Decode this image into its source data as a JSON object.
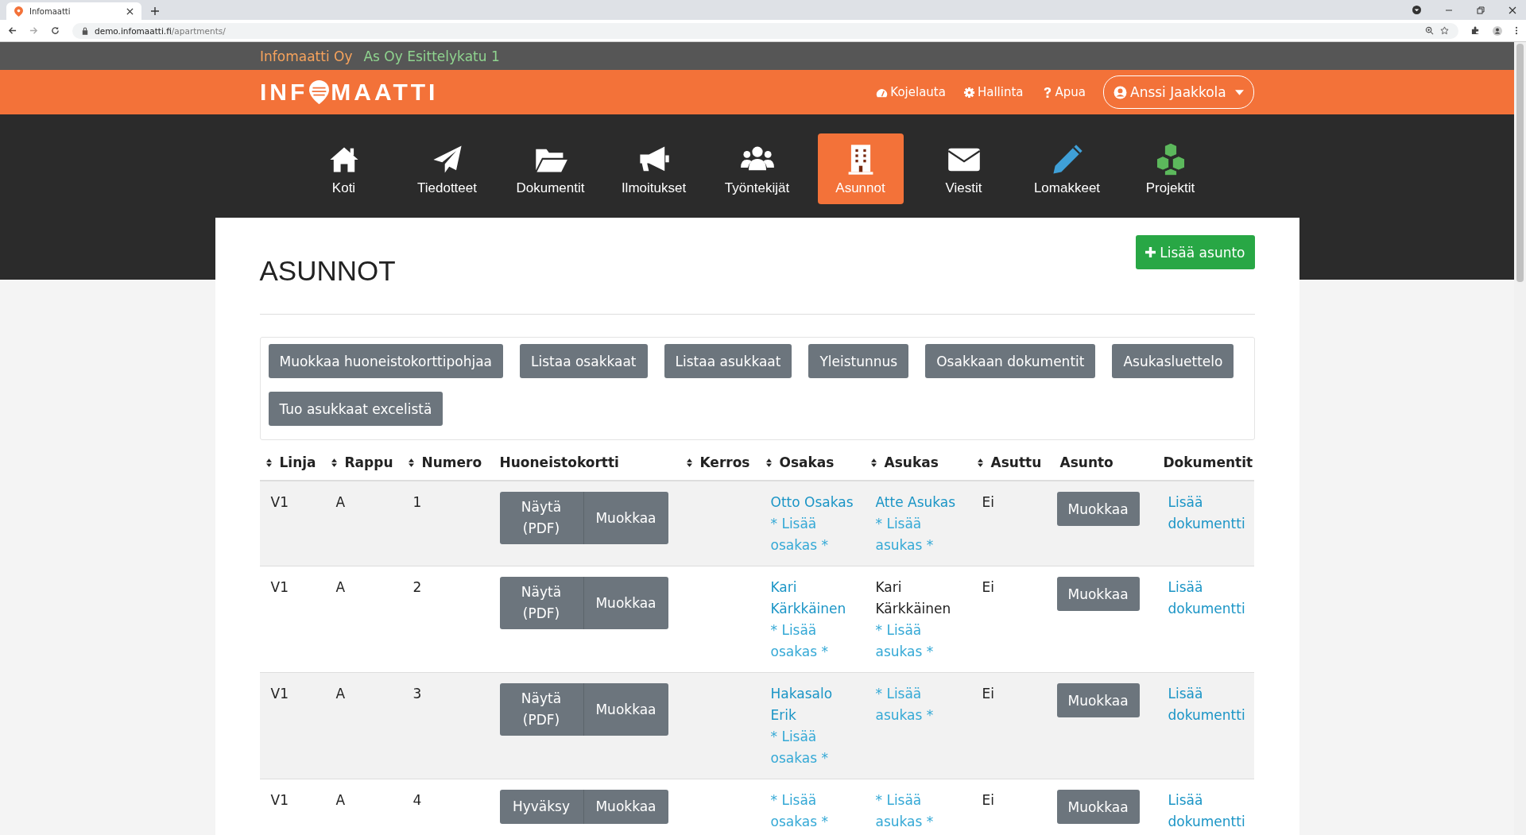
{
  "browser": {
    "tab_title": "Infomaatti",
    "url_domain": "demo.infomaatti.fi",
    "url_path": "/apartments/"
  },
  "topbar": {
    "company": "Infomaatti Oy",
    "association": "As Oy Esittelykatu 1"
  },
  "header": {
    "logo_left": "INF",
    "logo_right": "MAATTI",
    "links": [
      {
        "label": "Kojelauta"
      },
      {
        "label": "Hallinta"
      },
      {
        "label": "Apua"
      }
    ],
    "user": "Anssi Jaakkola"
  },
  "nav": [
    {
      "label": "Koti",
      "selected": false
    },
    {
      "label": "Tiedotteet",
      "selected": false
    },
    {
      "label": "Dokumentit",
      "selected": false
    },
    {
      "label": "Ilmoitukset",
      "selected": false
    },
    {
      "label": "Työntekijät",
      "selected": false
    },
    {
      "label": "Asunnot",
      "selected": true
    },
    {
      "label": "Viestit",
      "selected": false
    },
    {
      "label": "Lomakkeet",
      "selected": false
    },
    {
      "label": "Projektit",
      "selected": false
    }
  ],
  "page": {
    "title": "ASUNNOT",
    "add_button": "Lisää asunto",
    "actions": [
      "Muokkaa huoneistokorttipohjaa",
      "Listaa osakkaat",
      "Listaa asukkaat",
      "Yleistunnus",
      "Osakkaan dokumentit",
      "Asukasluettelo",
      "Tuo asukkaat excelistä"
    ]
  },
  "table": {
    "columns": [
      {
        "label": "Linja",
        "sortable": true
      },
      {
        "label": "Rappu",
        "sortable": true
      },
      {
        "label": "Numero",
        "sortable": true
      },
      {
        "label": "Huoneistokortti",
        "sortable": false
      },
      {
        "label": "Kerros",
        "sortable": true
      },
      {
        "label": "Osakas",
        "sortable": true
      },
      {
        "label": "Asukas",
        "sortable": true
      },
      {
        "label": "Asuttu",
        "sortable": true
      },
      {
        "label": "Asunto",
        "sortable": false
      },
      {
        "label": "Dokumentit",
        "sortable": false
      }
    ],
    "rows": [
      {
        "linja": "V1",
        "rappu": "A",
        "numero": "1",
        "card_buttons": [
          "Näytä (PDF)",
          "Muokkaa"
        ],
        "osakas": "Otto Osakas",
        "osakas_add": "* Lisää osakas *",
        "asukas": "Atte Asukas",
        "asukas_linked": true,
        "asukas_add": "* Lisää asukas *",
        "asuttu": "Ei",
        "edit": "Muokkaa",
        "document": "Lisää dokumentti"
      },
      {
        "linja": "V1",
        "rappu": "A",
        "numero": "2",
        "card_buttons": [
          "Näytä (PDF)",
          "Muokkaa"
        ],
        "osakas": "Kari Kärkkäinen",
        "osakas_add": "* Lisää osakas *",
        "asukas": "Kari Kärkkäinen",
        "asukas_linked": false,
        "asukas_add": "* Lisää asukas *",
        "asuttu": "Ei",
        "edit": "Muokkaa",
        "document": "Lisää dokumentti"
      },
      {
        "linja": "V1",
        "rappu": "A",
        "numero": "3",
        "card_buttons": [
          "Näytä (PDF)",
          "Muokkaa"
        ],
        "osakas": "Hakasalo Erik",
        "osakas_add": "* Lisää osakas *",
        "asukas_add": "* Lisää asukas *",
        "asuttu": "Ei",
        "edit": "Muokkaa",
        "document": "Lisää dokumentti"
      },
      {
        "linja": "V1",
        "rappu": "A",
        "numero": "4",
        "card_buttons": [
          "Hyväksy",
          "Muokkaa"
        ],
        "osakas_add": "* Lisää osakas *",
        "asukas_add": "* Lisää asukas *",
        "asuttu": "Ei",
        "edit": "Muokkaa",
        "document": "Lisää dokumentti"
      }
    ]
  }
}
